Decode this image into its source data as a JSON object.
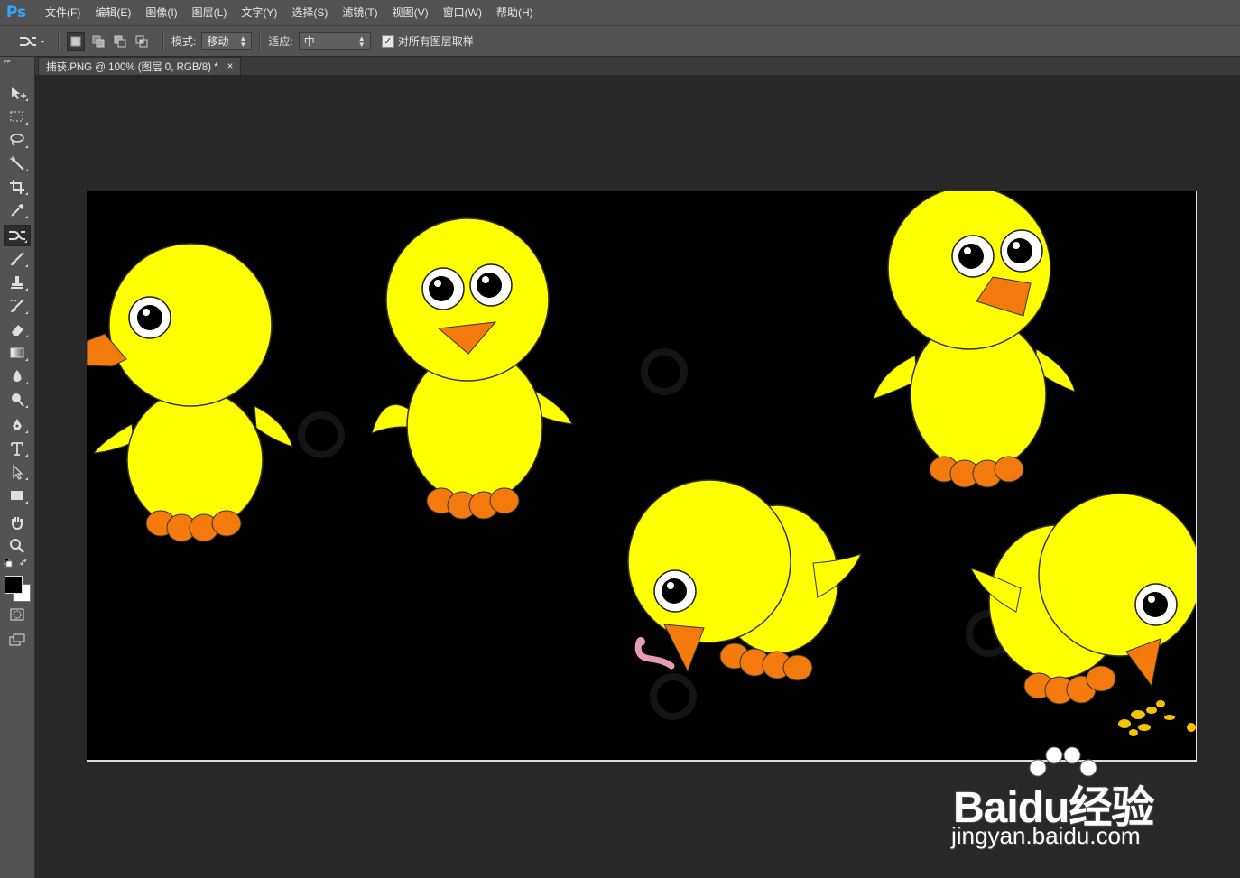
{
  "app": {
    "logo": "Ps"
  },
  "menu": [
    {
      "label": "文件(F)"
    },
    {
      "label": "编辑(E)"
    },
    {
      "label": "图像(I)"
    },
    {
      "label": "图层(L)"
    },
    {
      "label": "文字(Y)"
    },
    {
      "label": "选择(S)"
    },
    {
      "label": "滤镜(T)"
    },
    {
      "label": "视图(V)"
    },
    {
      "label": "窗口(W)"
    },
    {
      "label": "帮助(H)"
    }
  ],
  "options": {
    "mode_label": "模式:",
    "mode_value": "移动",
    "adapt_label": "适应:",
    "adapt_value": "中",
    "sample_all_layers_label": "对所有图层取样",
    "sample_all_layers_checked": true
  },
  "document": {
    "tab_title": "捕获.PNG @ 100% (图层 0, RGB/8) *",
    "close_glyph": "×"
  },
  "tools": [
    {
      "icon": "move-tool-icon"
    },
    {
      "icon": "marquee-tool-icon"
    },
    {
      "icon": "lasso-tool-icon"
    },
    {
      "icon": "magic-wand-tool-icon"
    },
    {
      "icon": "crop-tool-icon"
    },
    {
      "icon": "eyedropper-tool-icon"
    },
    {
      "icon": "content-aware-move-tool-icon",
      "active": true
    },
    {
      "icon": "brush-tool-icon"
    },
    {
      "icon": "clone-stamp-tool-icon"
    },
    {
      "icon": "history-brush-tool-icon"
    },
    {
      "icon": "eraser-tool-icon"
    },
    {
      "icon": "gradient-tool-icon"
    },
    {
      "icon": "blur-tool-icon"
    },
    {
      "icon": "dodge-tool-icon"
    },
    {
      "icon": "pen-tool-icon"
    },
    {
      "icon": "type-tool-icon"
    },
    {
      "icon": "path-selection-tool-icon"
    },
    {
      "icon": "rectangle-tool-icon"
    },
    {
      "icon": "hand-tool-icon"
    },
    {
      "icon": "zoom-tool-icon"
    }
  ],
  "colors": {
    "foreground": "#000000",
    "background": "#ffffff",
    "chick_yellow": "#ffff00",
    "beak_orange": "#f47a0e"
  },
  "watermark": {
    "brand": "Baidu经验",
    "url": "jingyan.baidu.com"
  }
}
